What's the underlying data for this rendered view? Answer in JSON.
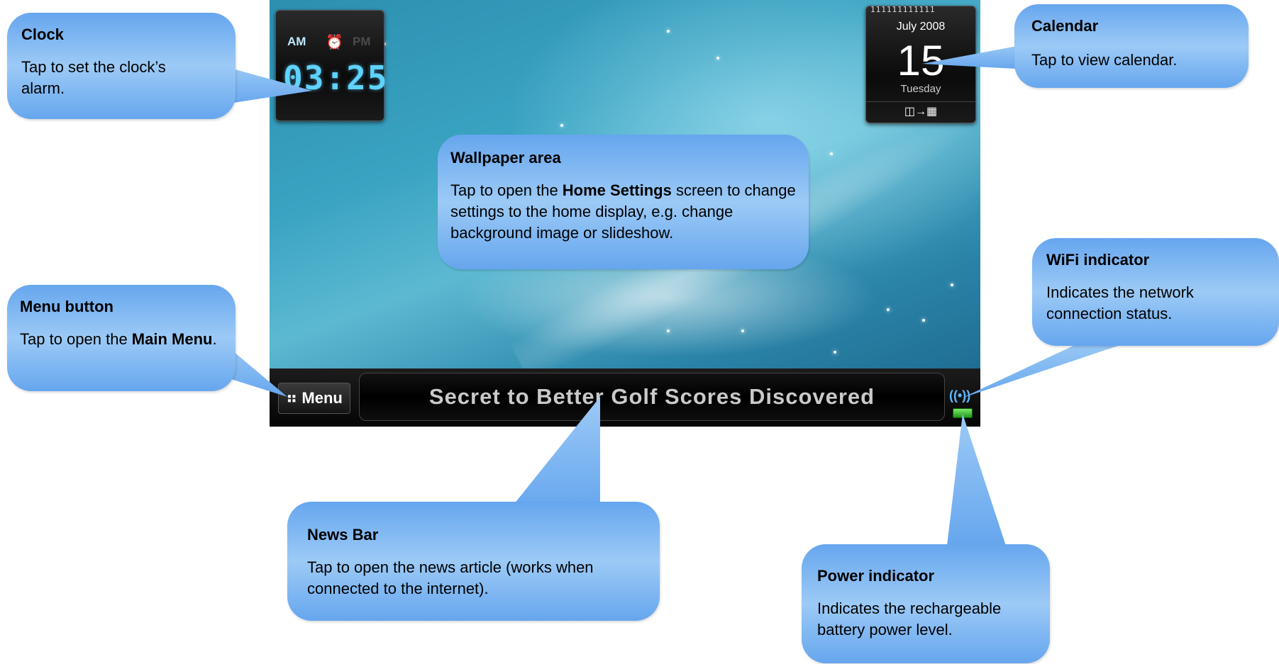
{
  "device": {
    "clock": {
      "am_label": "AM",
      "alarm_glyph": "⏰",
      "pm_label": "PM",
      "time": "03:25"
    },
    "calendar": {
      "rings": "111111111111",
      "month_year": "July  2008",
      "day": "15",
      "weekday": "Tuesday",
      "footer_glyph": "◫→▦"
    },
    "menu_button": {
      "glyph": "⠶",
      "label": "Menu"
    },
    "news_bar": {
      "headline": "Secret to Better Golf Scores Discovered"
    },
    "wifi_glyph": "((•))"
  },
  "callouts": {
    "clock": {
      "title": "Clock",
      "body": "Tap to set the clock’s alarm."
    },
    "calendar": {
      "title": "Calendar",
      "body": "Tap to view calendar."
    },
    "wallpaper": {
      "title": "Wallpaper area",
      "body_pre": "Tap to open the ",
      "body_bold": "Home Settings",
      "body_post": " screen to change settings to the home display, e.g. change background image or slideshow."
    },
    "wifi": {
      "title": "WiFi indicator",
      "body": "Indicates the network connection status."
    },
    "menu": {
      "title": "Menu button",
      "body_pre": "Tap to open the ",
      "body_bold": "Main Menu",
      "body_post": "."
    },
    "news": {
      "title": "News Bar",
      "body": "Tap to open the news article (works when connected to the internet)."
    },
    "power": {
      "title": "Power indicator",
      "body": "Indicates the rechargeable battery power level."
    }
  },
  "colors": {
    "callout_fill": "#9ccaf6",
    "callout_edge": "#66a6ee",
    "accent_cyan": "#5fd2ff"
  }
}
